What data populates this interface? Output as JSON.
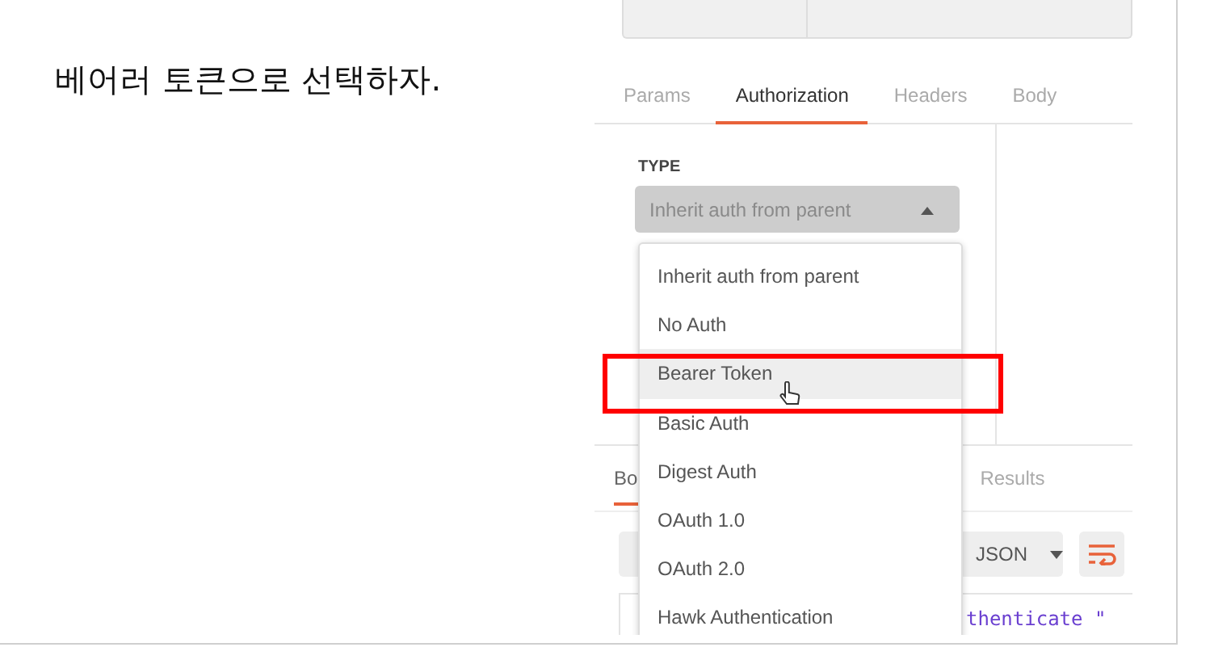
{
  "caption": "베어러 토큰으로 선택하자.",
  "request_tabs": [
    {
      "label": "Params",
      "selected": false
    },
    {
      "label": "Authorization",
      "selected": true
    },
    {
      "label": "Headers",
      "selected": false
    },
    {
      "label": "Body",
      "selected": false
    }
  ],
  "auth": {
    "type_label": "TYPE",
    "select_value": "Inherit auth from parent",
    "expanded": true
  },
  "dropdown_items": [
    {
      "label": "Inherit auth from parent",
      "hovered": false,
      "highlighted": false
    },
    {
      "label": "No Auth",
      "hovered": false,
      "highlighted": false
    },
    {
      "label": "Bearer Token",
      "hovered": true,
      "highlighted": true
    },
    {
      "label": "Basic Auth",
      "hovered": false,
      "highlighted": false
    },
    {
      "label": "Digest Auth",
      "hovered": false,
      "highlighted": false
    },
    {
      "label": "OAuth 1.0",
      "hovered": false,
      "highlighted": false
    },
    {
      "label": "OAuth 2.0",
      "hovered": false,
      "highlighted": false
    },
    {
      "label": "Hawk Authentication",
      "hovered": false,
      "highlighted": false
    }
  ],
  "response_tabs": [
    {
      "label": "Bo",
      "selected": true
    },
    {
      "label": "Results",
      "selected": false
    }
  ],
  "response": {
    "format": "JSON",
    "code_line": "thenticate \""
  }
}
